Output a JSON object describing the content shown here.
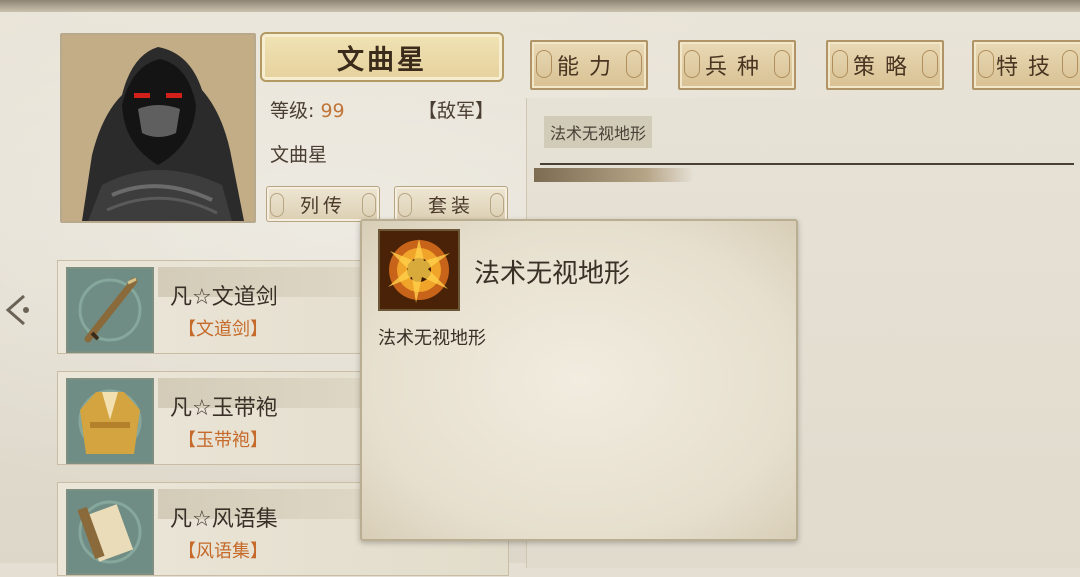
{
  "hero": {
    "name": "文曲星",
    "level_label": "等级:",
    "level_value": "99",
    "faction": "【敌军】",
    "subtitle": "文曲星",
    "btn_biography": "列传",
    "btn_set": "套装"
  },
  "tabs": [
    {
      "label": "能力"
    },
    {
      "label": "兵种"
    },
    {
      "label": "策略"
    },
    {
      "label": "特技"
    }
  ],
  "equipment": [
    {
      "name": "凡☆文道剑",
      "tag": "【文道剑】",
      "icon": "sword-icon"
    },
    {
      "name": "凡☆玉带袍",
      "tag": "【玉带袍】",
      "icon": "robe-icon"
    },
    {
      "name": "凡☆风语集",
      "tag": "【风语集】",
      "icon": "scroll-icon"
    }
  ],
  "skills": {
    "selected": "法术无视地形"
  },
  "tooltip": {
    "title": "法术无视地形",
    "description": "法术无视地形",
    "icon": "fire-burst-icon"
  },
  "colors": {
    "level": "#c07538",
    "equip_tag": "#c56a2a"
  }
}
